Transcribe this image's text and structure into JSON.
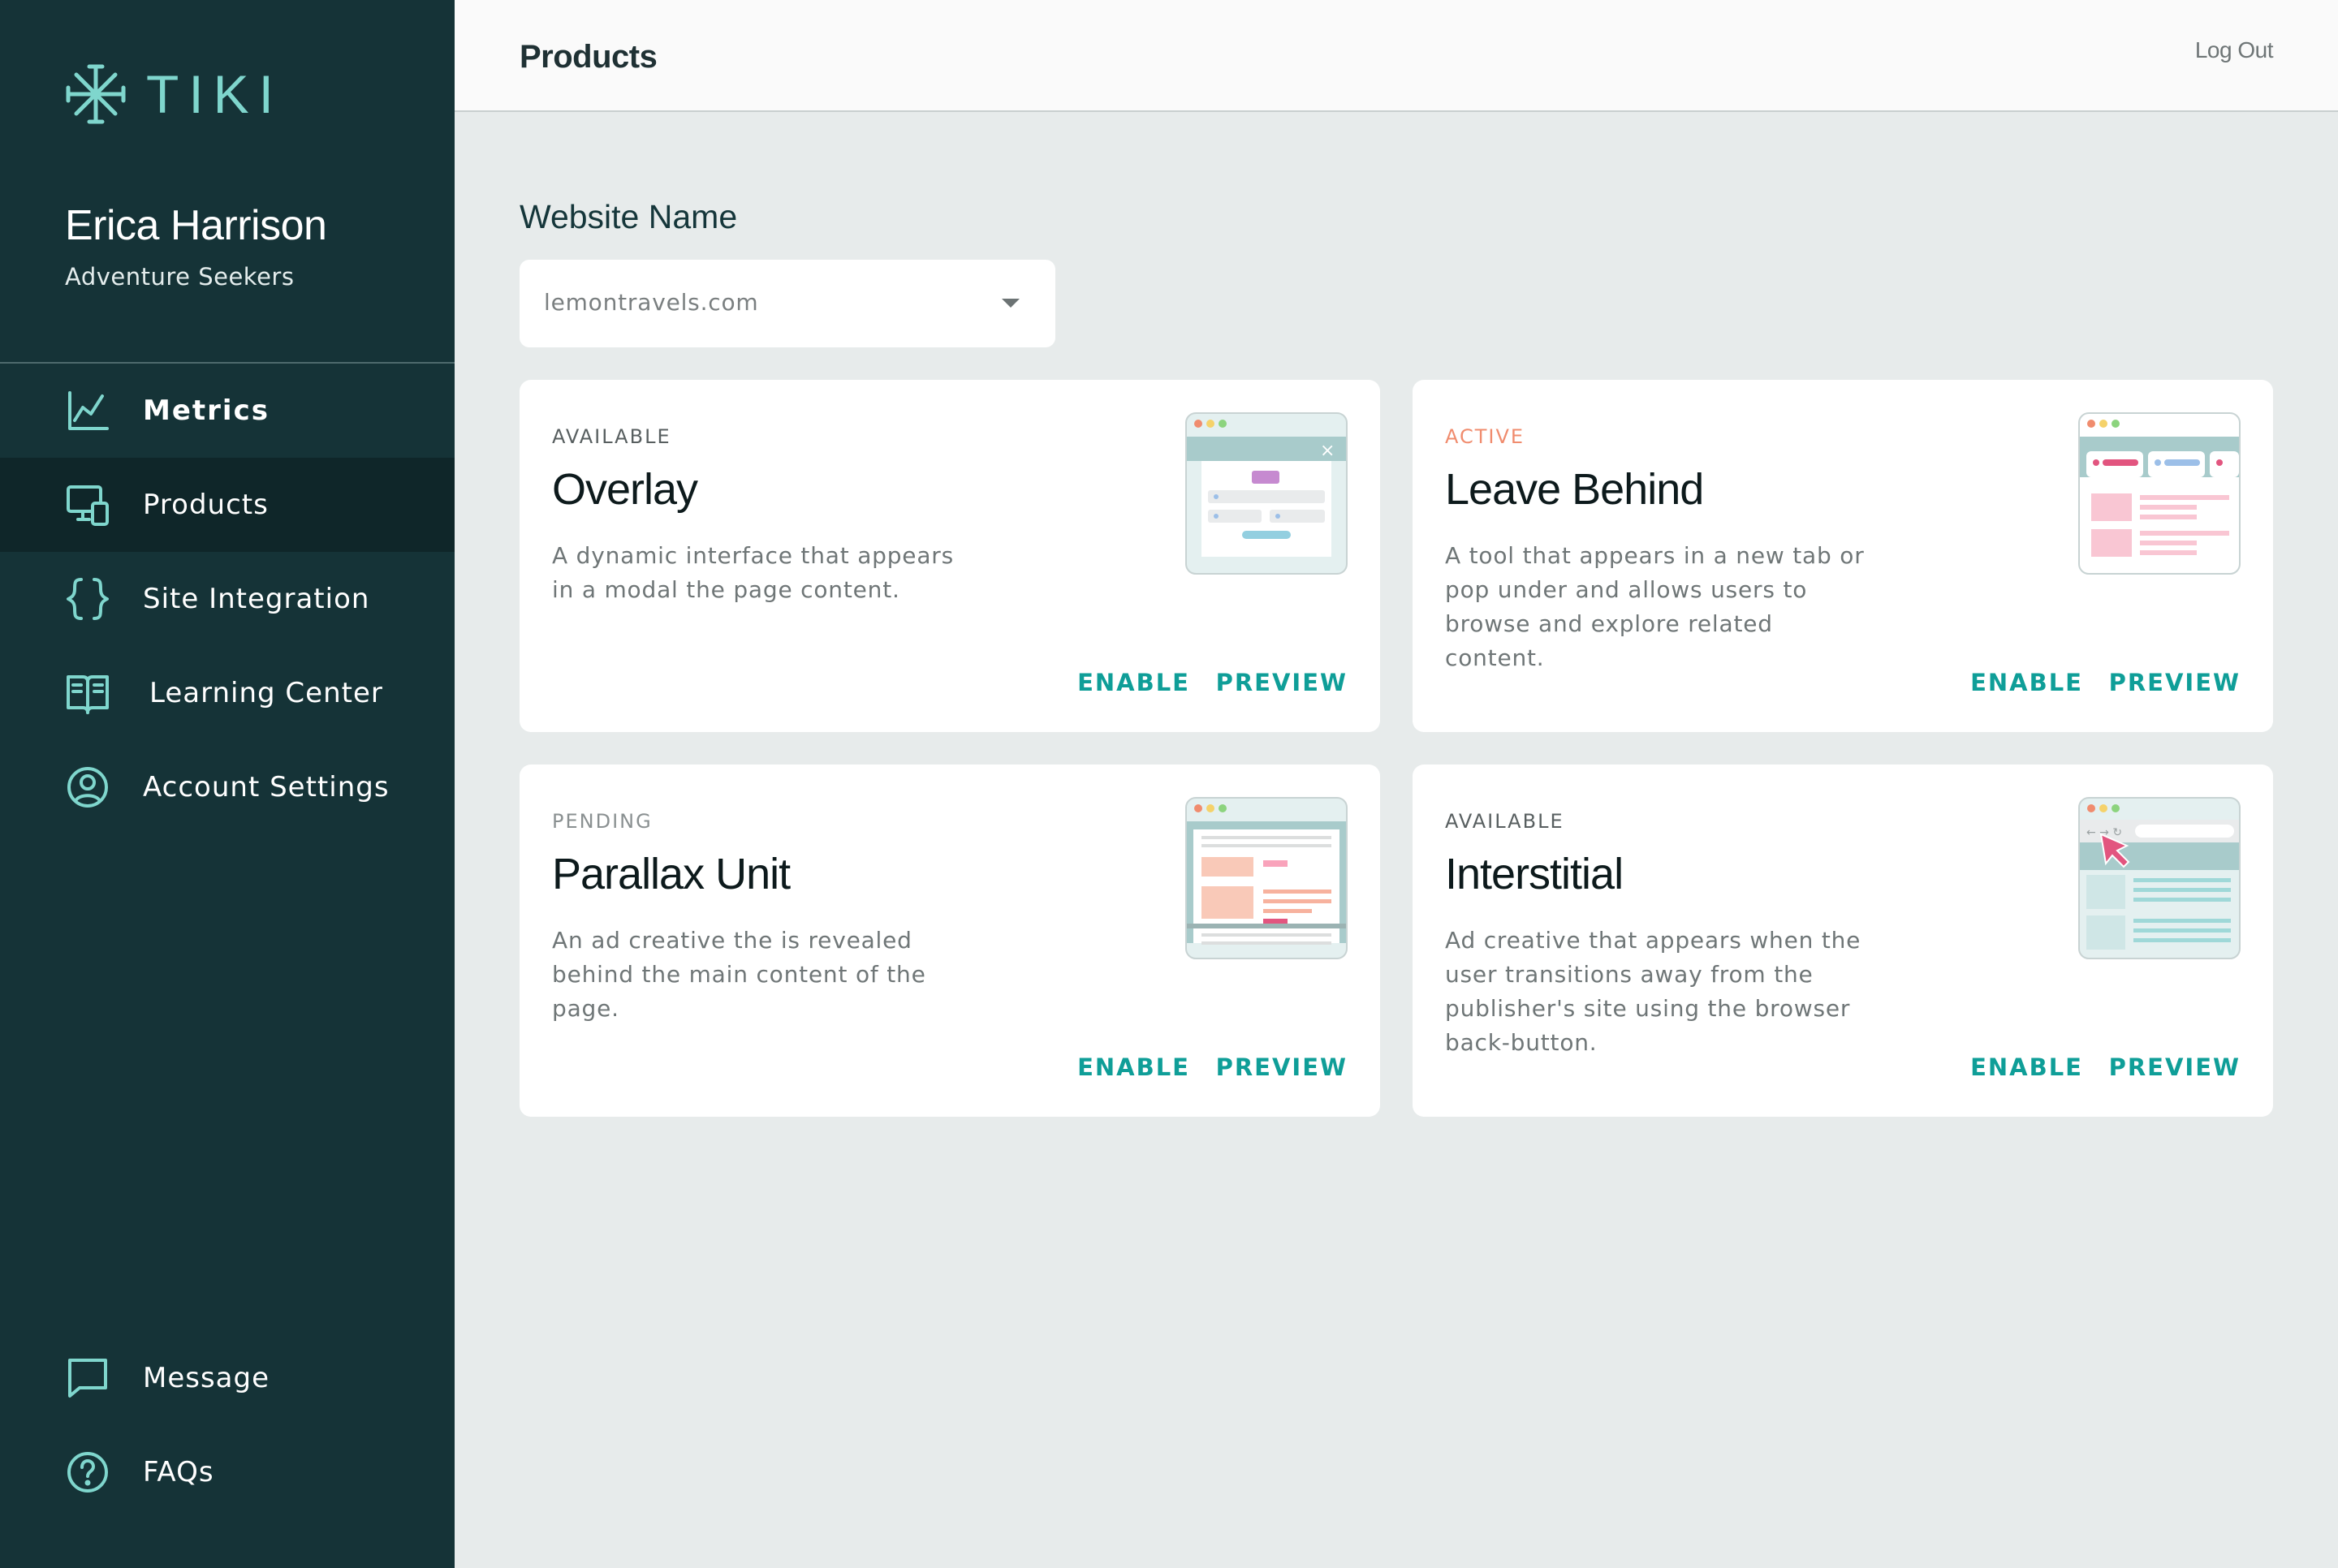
{
  "brand": {
    "name": "TIKI",
    "accent": "#7fd6cd",
    "sidebar_bg": "#153337",
    "link_color": "#0f9e98"
  },
  "user": {
    "name": "Erica Harrison",
    "organization": "Adventure Seekers"
  },
  "nav": {
    "items": [
      {
        "label": "Metrics",
        "icon": "line-chart-icon"
      },
      {
        "label": "Products",
        "icon": "devices-icon",
        "active": true
      },
      {
        "label": "Site Integration",
        "icon": "braces-icon"
      },
      {
        "label": "Learning Center",
        "icon": "book-icon"
      },
      {
        "label": "Account Settings",
        "icon": "user-circle-icon"
      }
    ],
    "bottom": [
      {
        "label": "Message",
        "icon": "chat-icon"
      },
      {
        "label": "FAQs",
        "icon": "help-icon"
      }
    ]
  },
  "header": {
    "title": "Products",
    "logout": "Log Out"
  },
  "website": {
    "label": "Website Name",
    "value": "lemontravels.com"
  },
  "products": [
    {
      "status": "AVAILABLE",
      "title": "Overlay",
      "description": "A dynamic interface that appears in a modal the page content.",
      "enable": "ENABLE",
      "preview": "PREVIEW"
    },
    {
      "status": "ACTIVE",
      "title": "Leave Behind",
      "description": "A tool that appears in a new tab or pop under and allows users to browse and explore related content.",
      "enable": "ENABLE",
      "preview": "PREVIEW"
    },
    {
      "status": "PENDING",
      "title": "Parallax Unit",
      "description": "An ad creative the is revealed behind the main content of the page.",
      "enable": "ENABLE",
      "preview": "PREVIEW"
    },
    {
      "status": "AVAILABLE",
      "title": "Interstitial",
      "description": "Ad creative that appears when the user transitions away from the publisher's site using the browser back-button.",
      "enable": "ENABLE",
      "preview": "PREVIEW"
    }
  ]
}
